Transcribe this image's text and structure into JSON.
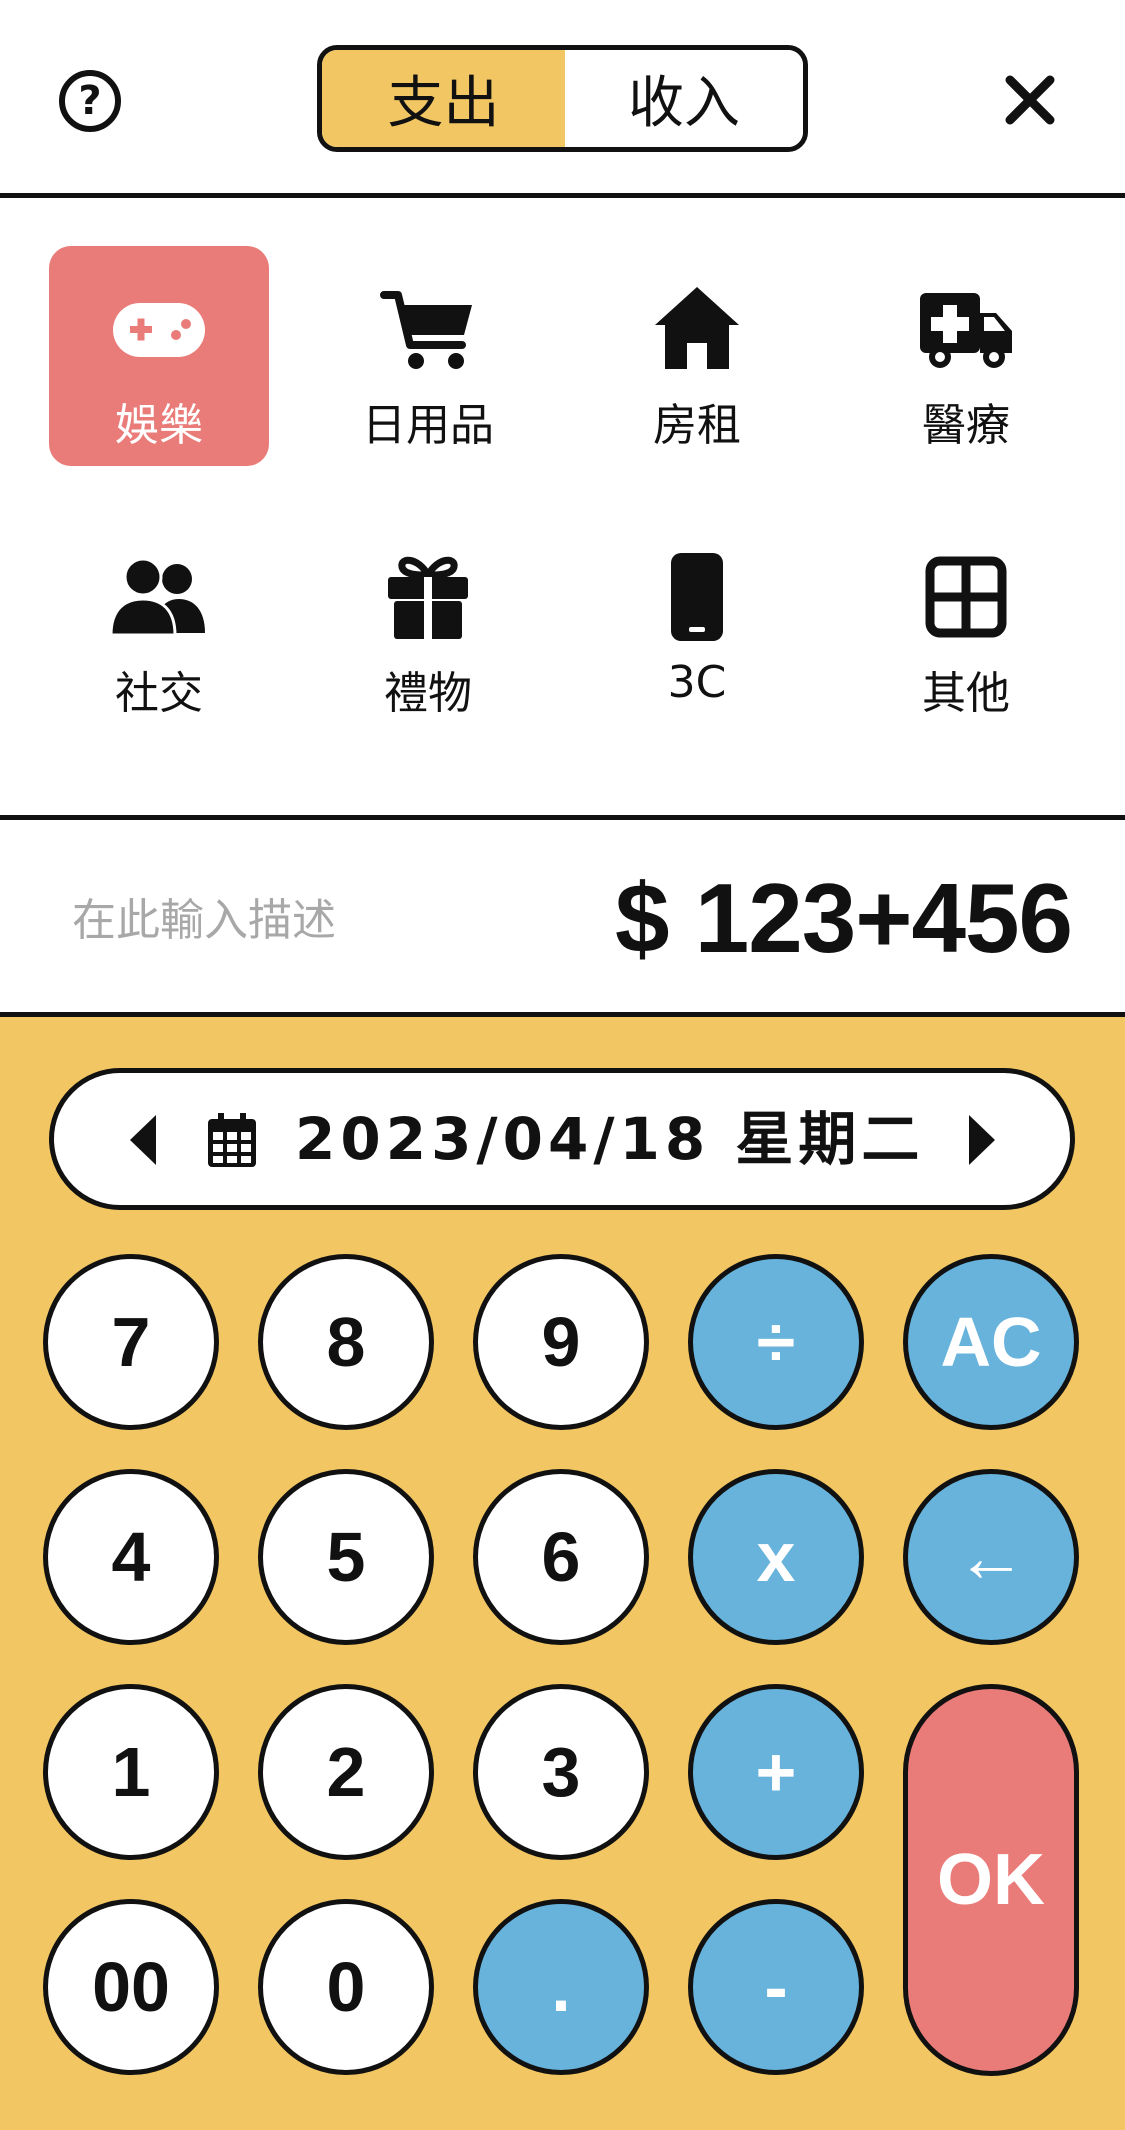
{
  "header": {
    "help_icon": "question-circle-icon",
    "help_glyph": "?",
    "toggle": {
      "expense": "支出",
      "income": "收入",
      "active": "expense"
    },
    "close_icon": "close-icon"
  },
  "categories": [
    {
      "label": "娛樂",
      "icon": "gamepad-icon",
      "selected": true
    },
    {
      "label": "日用品",
      "icon": "cart-icon",
      "selected": false
    },
    {
      "label": "房租",
      "icon": "home-icon",
      "selected": false
    },
    {
      "label": "醫療",
      "icon": "ambulance-icon",
      "selected": false
    },
    {
      "label": "社交",
      "icon": "users-icon",
      "selected": false
    },
    {
      "label": "禮物",
      "icon": "gift-icon",
      "selected": false
    },
    {
      "label": "3C",
      "icon": "phone-icon",
      "selected": false
    },
    {
      "label": "其他",
      "icon": "grid-icon",
      "selected": false
    }
  ],
  "entry": {
    "description_placeholder": "在此輸入描述",
    "amount": "$ 123+456"
  },
  "date_bar": {
    "date_text": "2023/04/18 星期二",
    "prev_icon": "caret-left-icon",
    "next_icon": "caret-right-icon",
    "calendar_icon": "calendar-icon"
  },
  "keypad": {
    "keys": [
      "7",
      "8",
      "9",
      "÷",
      "AC",
      "4",
      "5",
      "6",
      "x",
      "←",
      "1",
      "2",
      "3",
      "+",
      "OK",
      "00",
      "0",
      ".",
      "-"
    ]
  },
  "colors": {
    "accent_yellow": "#f2c662",
    "selected_red": "#e97b78",
    "operator_blue": "#67b3dc",
    "ok_red": "#e97b78",
    "placeholder_gray": "#a8a8a8"
  }
}
